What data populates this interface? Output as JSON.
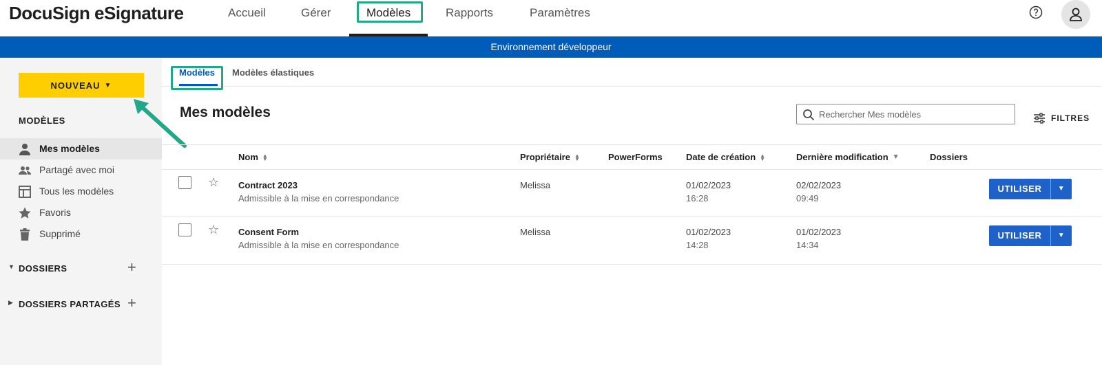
{
  "app": {
    "brand": "DocuSign eSignature"
  },
  "topnav": {
    "items": [
      {
        "label": "Accueil"
      },
      {
        "label": "Gérer"
      },
      {
        "label": "Modèles"
      },
      {
        "label": "Rapports"
      },
      {
        "label": "Paramètres"
      }
    ],
    "active": "Modèles"
  },
  "banner": {
    "text": "Environnement développeur"
  },
  "sidebar": {
    "new_button": "NOUVEAU",
    "heading": "MODÈLES",
    "items": [
      {
        "label": "Mes modèles",
        "icon": "person-icon",
        "active": true
      },
      {
        "label": "Partagé avec moi",
        "icon": "people-icon"
      },
      {
        "label": "Tous les modèles",
        "icon": "template-icon"
      },
      {
        "label": "Favoris",
        "icon": "star-icon"
      },
      {
        "label": "Supprimé",
        "icon": "trash-icon"
      }
    ],
    "sections": [
      {
        "label": "DOSSIERS"
      },
      {
        "label": "DOSSIERS PARTAGÉS"
      }
    ]
  },
  "subtabs": [
    {
      "label": "Modèles",
      "active": true
    },
    {
      "label": "Modèles élastiques"
    }
  ],
  "main": {
    "title": "Mes modèles",
    "search_placeholder": "Rechercher Mes modèles",
    "filters_label": "FILTRES"
  },
  "table": {
    "columns": [
      "Nom",
      "Propriétaire",
      "PowerForms",
      "Date de création",
      "Dernière modification",
      "Dossiers"
    ],
    "rows": [
      {
        "name": "Contract 2023",
        "status": "Admissible à la mise en correspondance",
        "owner": "Melissa",
        "created_date": "01/02/2023",
        "created_time": "16:28",
        "modified_date": "02/02/2023",
        "modified_time": "09:49",
        "action": "UTILISER"
      },
      {
        "name": "Consent Form",
        "status": "Admissible à la mise en correspondance",
        "owner": "Melissa",
        "created_date": "01/02/2023",
        "created_time": "14:28",
        "modified_date": "01/02/2023",
        "modified_time": "14:34",
        "action": "UTILISER"
      }
    ]
  },
  "colors": {
    "banner": "#005cb9",
    "new_button": "#ffce00",
    "primary_button": "#1e62c9",
    "highlight": "#22a889"
  }
}
